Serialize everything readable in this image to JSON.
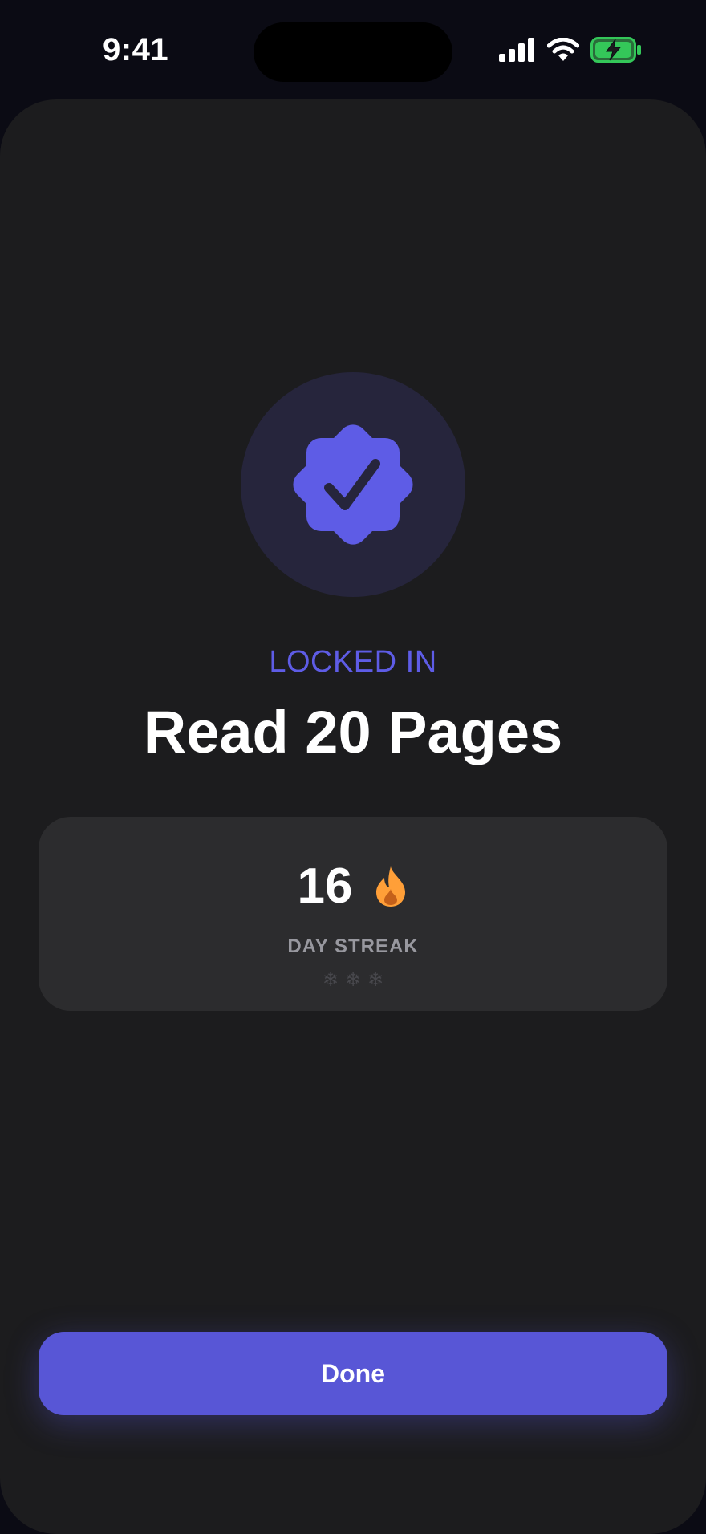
{
  "status_bar": {
    "time": "9:41",
    "icons": [
      "cellular-signal-icon",
      "wifi-icon",
      "battery-charging-icon"
    ],
    "battery_color": "#34c759"
  },
  "badge": {
    "icon": "checkmark-seal-icon",
    "color": "#5e5ce6"
  },
  "eyebrow": "LOCKED IN",
  "title": "Read 20 Pages",
  "streak": {
    "count": "16",
    "icon": "flame-icon",
    "icon_color": "#ff9f38",
    "label": "DAY STREAK",
    "freezes": [
      "❄",
      "❄",
      "❄"
    ]
  },
  "done_label": "Done",
  "colors": {
    "accent": "#5856d6",
    "background": "#0b0b14",
    "sheet": "#1c1c1e",
    "card": "#2c2c2e"
  }
}
